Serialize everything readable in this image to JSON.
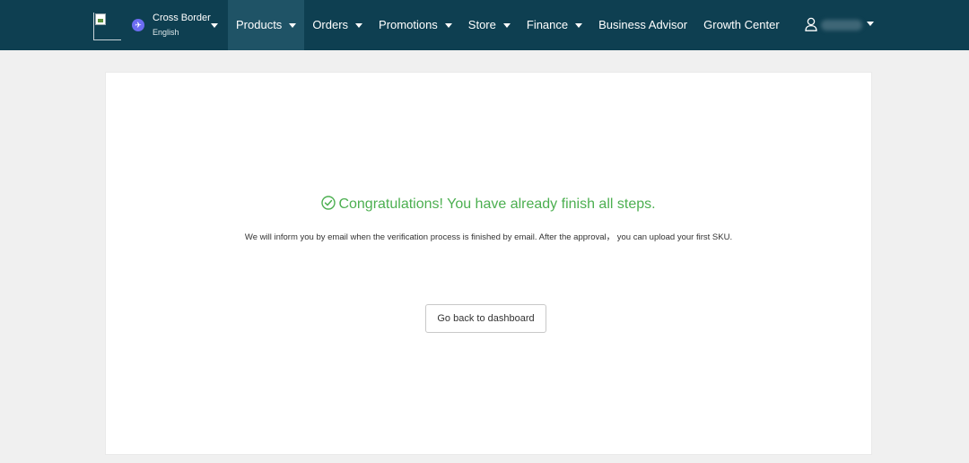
{
  "header": {
    "region": {
      "name": "Cross Border",
      "language": "English"
    },
    "nav": [
      {
        "label": "Products",
        "has_dropdown": true,
        "active": true
      },
      {
        "label": "Orders",
        "has_dropdown": true,
        "active": false
      },
      {
        "label": "Promotions",
        "has_dropdown": true,
        "active": false
      },
      {
        "label": "Store",
        "has_dropdown": true,
        "active": false
      },
      {
        "label": "Finance",
        "has_dropdown": true,
        "active": false
      },
      {
        "label": "Business Advisor",
        "has_dropdown": false,
        "active": false
      },
      {
        "label": "Growth Center",
        "has_dropdown": false,
        "active": false
      }
    ],
    "user": {
      "icon": "user-icon"
    }
  },
  "main": {
    "success_title": "Congratulations! You have already finish all steps.",
    "info_text": "We will inform you by email when the verification process is finished by email. After the approval， you can upload your first SKU.",
    "back_button_label": "Go back to dashboard"
  },
  "colors": {
    "header_bg": "#0e3f51",
    "active_nav_bg": "#1f5366",
    "success_green": "#4caf50",
    "page_bg": "#f0f0f0"
  }
}
